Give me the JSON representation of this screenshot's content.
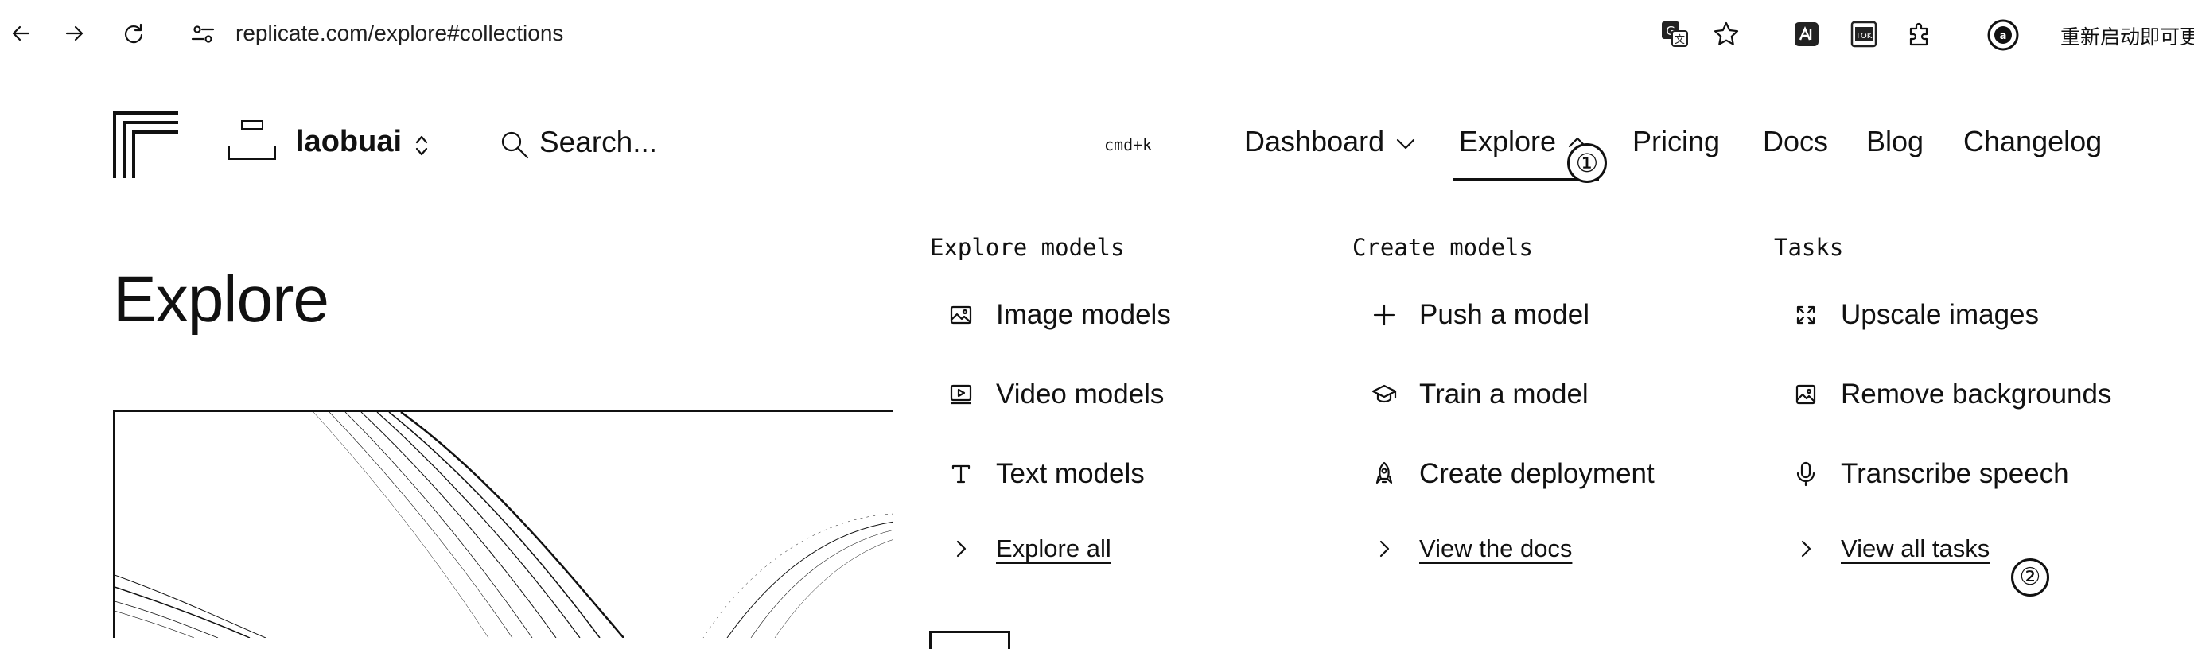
{
  "browser": {
    "url": "replicate.com/explore#collections",
    "restart_text": "重新启动即可更",
    "icons": [
      "back-arrow-icon",
      "forward-arrow-icon",
      "reload-icon",
      "site-settings-icon",
      "translate-icon",
      "star-icon",
      "extension-icon",
      "extension-icon",
      "puzzle-icon",
      "profile-icon"
    ]
  },
  "header": {
    "username": "laobuai",
    "search_placeholder": "Search...",
    "shortcut": "cmd+k",
    "nav": {
      "dashboard": "Dashboard",
      "explore": "Explore",
      "pricing": "Pricing",
      "docs": "Docs",
      "blog": "Blog",
      "changelog": "Changelog"
    }
  },
  "page": {
    "title": "Explore"
  },
  "menu": {
    "explore_models": {
      "heading": "Explore models",
      "items": [
        "Image models",
        "Video models",
        "Text models"
      ],
      "link": "Explore all"
    },
    "create_models": {
      "heading": "Create models",
      "items": [
        "Push a model",
        "Train a model",
        "Create deployment"
      ],
      "link": "View the docs"
    },
    "tasks": {
      "heading": "Tasks",
      "items": [
        "Upscale images",
        "Remove backgrounds",
        "Transcribe speech"
      ],
      "link": "View all tasks"
    }
  },
  "annotations": {
    "marker_1": "①",
    "marker_2": "②"
  }
}
